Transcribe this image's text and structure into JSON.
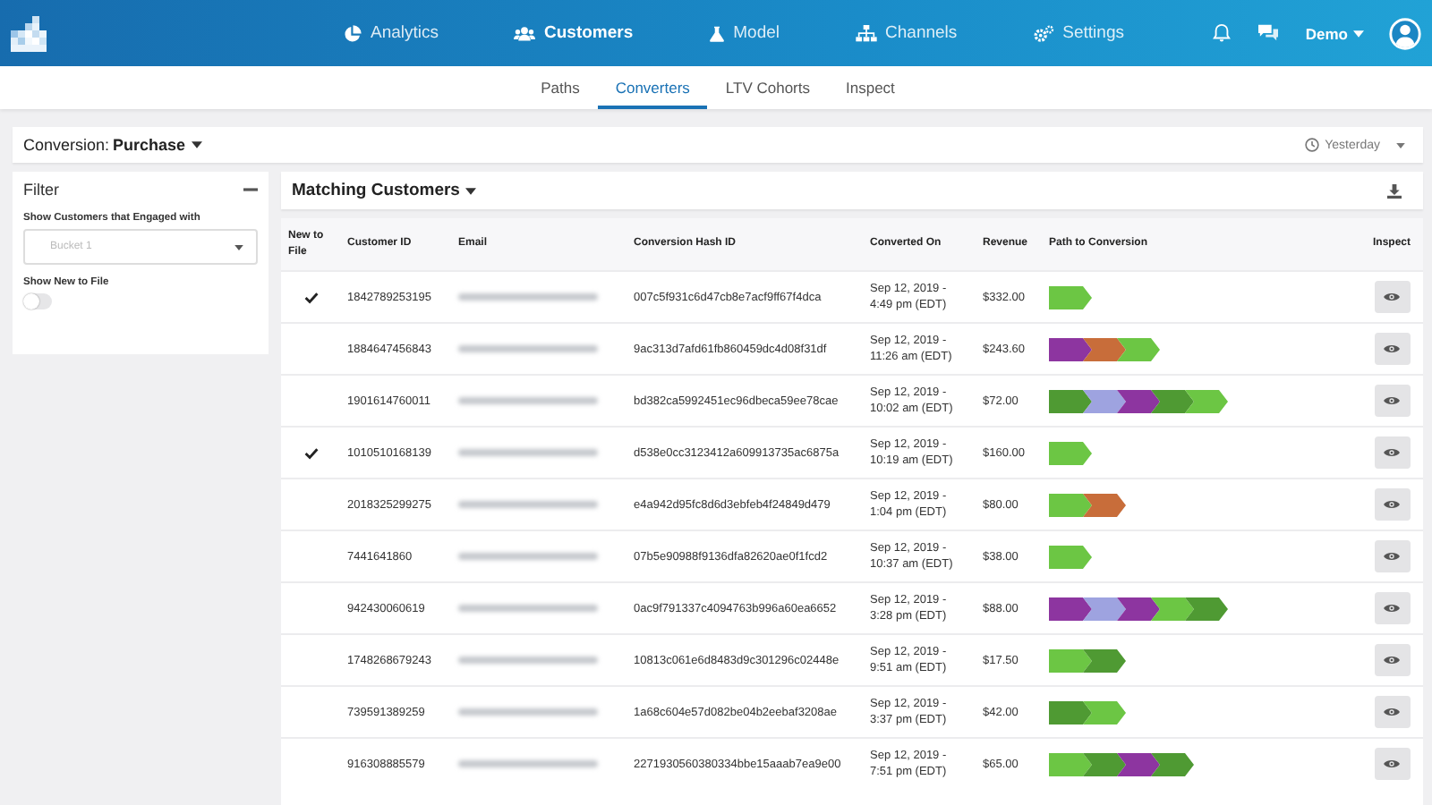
{
  "nav": {
    "items": [
      {
        "label": "Analytics",
        "selected": false
      },
      {
        "label": "Customers",
        "selected": true
      },
      {
        "label": "Model",
        "selected": false
      },
      {
        "label": "Channels",
        "selected": false
      },
      {
        "label": "Settings",
        "selected": false
      }
    ],
    "user": "Demo"
  },
  "subtabs": [
    {
      "label": "Paths",
      "selected": false
    },
    {
      "label": "Converters",
      "selected": true
    },
    {
      "label": "LTV Cohorts",
      "selected": false
    },
    {
      "label": "Inspect",
      "selected": false
    }
  ],
  "conversion": {
    "label": "Conversion:",
    "value": "Purchase",
    "date_range": "Yesterday"
  },
  "filter": {
    "title": "Filter",
    "engaged_label": "Show Customers that Engaged with",
    "engaged_select": {
      "placeholder": "Bucket 1"
    },
    "new_to_file": {
      "label": "Show New to File",
      "on": false
    }
  },
  "table": {
    "title": "Matching Customers",
    "columns": [
      "New to File",
      "Customer ID",
      "Email",
      "Conversion Hash ID",
      "Converted On",
      "Revenue",
      "Path to Conversion",
      "Inspect"
    ],
    "rows": [
      {
        "new_to_file": true,
        "customer_id": "1842789253195",
        "hash": "007c5f931c6d47cb8e7acf9ff67f4dca",
        "converted_on": [
          "Sep 12, 2019 -",
          "4:49 pm (EDT)"
        ],
        "revenue": "$332.00",
        "path": [
          {
            "color": "#6cc644"
          }
        ]
      },
      {
        "new_to_file": false,
        "customer_id": "1884647456843",
        "hash": "9ac313d7afd61fb860459dc4d08f31df",
        "converted_on": [
          "Sep 12, 2019 -",
          "11:26 am (EDT)"
        ],
        "revenue": "$243.60",
        "path": [
          {
            "color": "#8d35a0"
          },
          {
            "color": "#c86d3a"
          },
          {
            "color": "#6cc644"
          }
        ]
      },
      {
        "new_to_file": false,
        "customer_id": "1901614760011",
        "hash": "bd382ca5992451ec96dbeca59ee78cae",
        "converted_on": [
          "Sep 12, 2019 -",
          "10:02 am (EDT)"
        ],
        "revenue": "$72.00",
        "path": [
          {
            "color": "#4f9a33"
          },
          {
            "color": "#9ea3e0"
          },
          {
            "color": "#8d35a0"
          },
          {
            "color": "#4f9a33"
          },
          {
            "color": "#6cc644"
          }
        ]
      },
      {
        "new_to_file": true,
        "customer_id": "1010510168139",
        "hash": "d538e0cc3123412a609913735ac6875a",
        "converted_on": [
          "Sep 12, 2019 -",
          "10:19 am (EDT)"
        ],
        "revenue": "$160.00",
        "path": [
          {
            "color": "#6cc644"
          }
        ]
      },
      {
        "new_to_file": false,
        "customer_id": "2018325299275",
        "hash": "e4a942d95fc8d6d3ebfeb4f24849d479",
        "converted_on": [
          "Sep 12, 2019 -",
          "1:04 pm (EDT)"
        ],
        "revenue": "$80.00",
        "path": [
          {
            "color": "#6cc644"
          },
          {
            "color": "#c86d3a"
          }
        ]
      },
      {
        "new_to_file": false,
        "customer_id": "7441641860",
        "hash": "07b5e90988f9136dfa82620ae0f1fcd2",
        "converted_on": [
          "Sep 12, 2019 -",
          "10:37 am (EDT)"
        ],
        "revenue": "$38.00",
        "path": [
          {
            "color": "#6cc644"
          }
        ]
      },
      {
        "new_to_file": false,
        "customer_id": "942430060619",
        "hash": "0ac9f791337c4094763b996a60ea6652",
        "converted_on": [
          "Sep 12, 2019 -",
          "3:28 pm (EDT)"
        ],
        "revenue": "$88.00",
        "path": [
          {
            "color": "#8d35a0"
          },
          {
            "color": "#9ea3e0"
          },
          {
            "color": "#8d35a0"
          },
          {
            "color": "#6cc644"
          },
          {
            "color": "#4f9a33"
          }
        ]
      },
      {
        "new_to_file": false,
        "customer_id": "1748268679243",
        "hash": "10813c061e6d8483d9c301296c02448e",
        "converted_on": [
          "Sep 12, 2019 -",
          "9:51 am (EDT)"
        ],
        "revenue": "$17.50",
        "path": [
          {
            "color": "#6cc644"
          },
          {
            "color": "#4f9a33"
          }
        ]
      },
      {
        "new_to_file": false,
        "customer_id": "739591389259",
        "hash": "1a68c604e57d082be04b2eebaf3208ae",
        "converted_on": [
          "Sep 12, 2019 -",
          "3:37 pm (EDT)"
        ],
        "revenue": "$42.00",
        "path": [
          {
            "color": "#4f9a33"
          },
          {
            "color": "#6cc644"
          }
        ]
      },
      {
        "new_to_file": false,
        "customer_id": "916308885579",
        "hash": "2271930560380334bbe15aaab7ea9e00",
        "converted_on": [
          "Sep 12, 2019 -",
          "7:51 pm (EDT)"
        ],
        "revenue": "$65.00",
        "path": [
          {
            "color": "#6cc644"
          },
          {
            "color": "#4f9a33"
          },
          {
            "color": "#8d35a0"
          },
          {
            "color": "#4f9a33"
          }
        ]
      }
    ]
  }
}
